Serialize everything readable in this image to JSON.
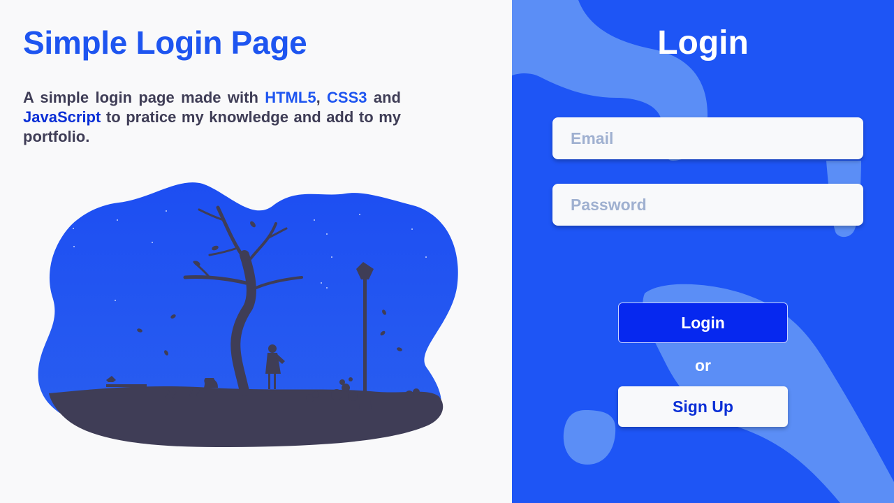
{
  "colors": {
    "accent": "#1e55f0",
    "accent_dark": "#0a2fd6",
    "panel_background": "#1e55f5",
    "page_background": "#f9f9fa",
    "text_dark": "#3f3d56",
    "login_button": "#0628ef"
  },
  "intro": {
    "title": "Simple Login Page",
    "desc_part1": "A simple login page made with ",
    "tech_html": "HTML5",
    "comma": ", ",
    "tech_css": "CSS3",
    "and": " and ",
    "tech_js": "JavaScript",
    "desc_part2": " to pratice my knowledge and add to my portfolio."
  },
  "illustration": {
    "icon": "night-park-illustration"
  },
  "login": {
    "title": "Login",
    "email_placeholder": "Email",
    "password_placeholder": "Password",
    "login_button": "Login",
    "or_text": "or",
    "signup_button": "Sign Up"
  }
}
